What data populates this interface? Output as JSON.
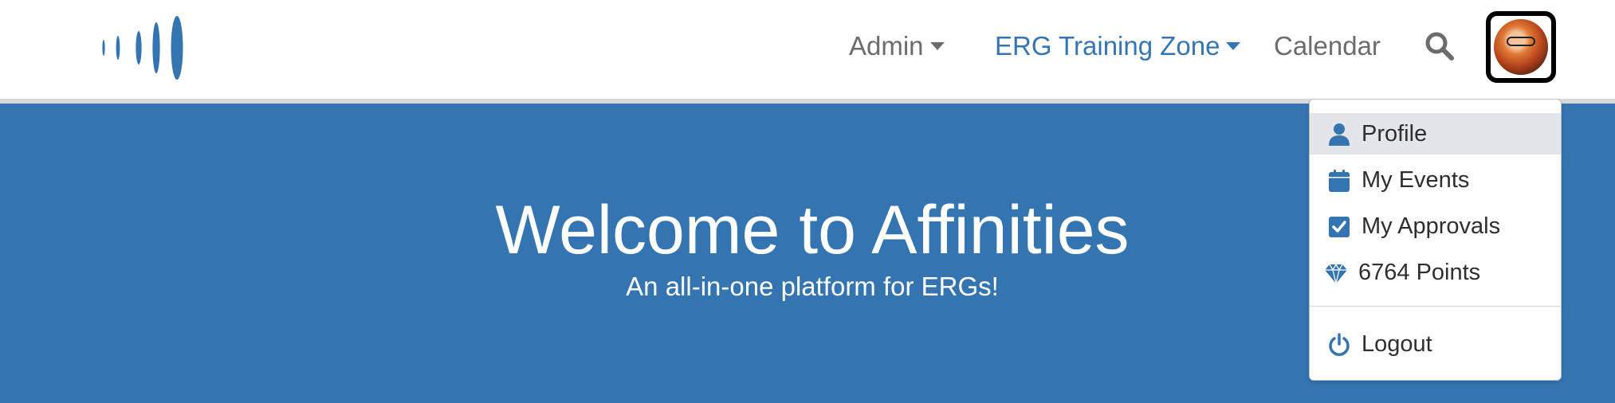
{
  "nav": {
    "logo_label": "",
    "items": [
      {
        "label": "Admin",
        "has_caret": true
      },
      {
        "label": "ERG Training Zone",
        "has_caret": true
      },
      {
        "label": "Calendar",
        "has_caret": false
      }
    ],
    "search_icon": "search-icon",
    "avatar": "user-avatar"
  },
  "hero": {
    "title": "Welcome to Affinities",
    "subtitle": "An all-in-one platform for ERGs!"
  },
  "user_menu": {
    "items": [
      {
        "label": "Profile",
        "icon": "user-icon"
      },
      {
        "label": "My Events",
        "icon": "calendar-icon"
      },
      {
        "label": "My Approvals",
        "icon": "checkbox-icon"
      },
      {
        "label": "6764 Points",
        "icon": "diamond-icon"
      },
      {
        "label": "Logout",
        "icon": "power-icon"
      }
    ]
  },
  "colors": {
    "brand_blue": "#3474b1",
    "nav_active": "#3575b3",
    "nav_text": "#6c6c6c",
    "menu_highlight": "#e4e5ea"
  }
}
